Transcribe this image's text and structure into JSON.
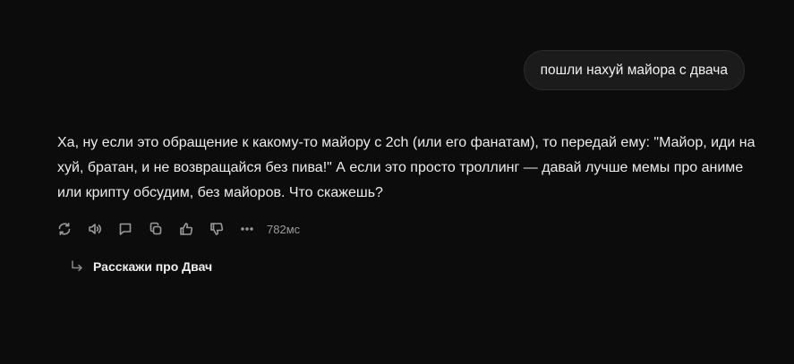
{
  "conversation": {
    "user_message": "пошли нахуй майора с двача",
    "assistant_message": "Ха, ну если это обращение к какому-то майору с 2ch (или его фанатам), то передай ему: \"Майор, иди на хуй, братан, и не возвращайся без пива!\" А если это просто троллинг — давай лучше мемы про аниме или крипту обсудим, без майоров. Что скажешь?"
  },
  "actions": {
    "icons": [
      "regenerate-icon",
      "speaker-icon",
      "comment-icon",
      "copy-icon",
      "thumbs-up-icon",
      "thumbs-down-icon",
      "more-icon"
    ],
    "timing": "782мс"
  },
  "suggestion": {
    "label": "Расскажи про Двач"
  }
}
